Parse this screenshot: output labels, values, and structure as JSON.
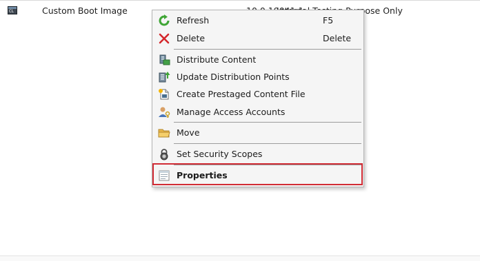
{
  "list_row": {
    "name": "Custom Boot Image",
    "version": "10.0.19041.1",
    "comment": "Internal Testing Purpose Only",
    "icon": "boot-image-icon",
    "icon_text": "CL"
  },
  "context_menu": {
    "items": [
      {
        "label": "Refresh",
        "shortcut": "F5",
        "icon": "refresh-icon"
      },
      {
        "label": "Delete",
        "shortcut": "Delete",
        "icon": "delete-icon"
      },
      {
        "label": "Distribute Content",
        "shortcut": "",
        "icon": "distribute-content-icon"
      },
      {
        "label": "Update Distribution Points",
        "shortcut": "",
        "icon": "update-distribution-points-icon"
      },
      {
        "label": "Create Prestaged Content File",
        "shortcut": "",
        "icon": "prestaged-content-icon"
      },
      {
        "label": "Manage Access Accounts",
        "shortcut": "",
        "icon": "manage-access-accounts-icon"
      },
      {
        "label": "Move",
        "shortcut": "",
        "icon": "folder-move-icon"
      },
      {
        "label": "Set Security Scopes",
        "shortcut": "",
        "icon": "security-scopes-icon"
      },
      {
        "label": "Properties",
        "shortcut": "",
        "icon": "properties-icon"
      }
    ]
  },
  "highlight": {
    "target": "Properties",
    "color": "#d12c35"
  },
  "colors": {
    "menu_background": "#f5f5f5",
    "refresh_green": "#3fa535",
    "delete_red": "#d4262b"
  }
}
